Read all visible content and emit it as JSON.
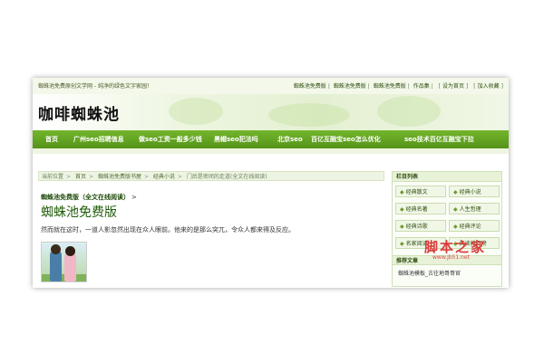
{
  "header": {
    "slogan": "蜘蛛池免费原创文学网 - 纯净的绿色文字家园！",
    "links": [
      "蜘蛛池免费版",
      "蜘蛛池免费版",
      "蜘蛛池免费版",
      "作品集",
      "设为首页",
      "加入收藏"
    ]
  },
  "logo": "咖啡蜘蛛池",
  "nav": {
    "items": [
      "首页",
      "广州seo招聘信息",
      "做seo工资一般多少钱",
      "黑帽seo犯法吗",
      "北京seo",
      "百亿互融宝seo怎么优化",
      "seo技术百亿互融宝下拉"
    ]
  },
  "breadcrumb": {
    "items": [
      "当前位置",
      "首页",
      "蜘蛛池免费版书屋",
      "经典小说",
      "门后是密闭的走道(全文在线阅读)"
    ]
  },
  "article": {
    "subtitle": "蜘蛛池免费版（全文在线阅读）",
    "subtitle_suffix": ">",
    "title": "蜘蛛池免费版",
    "intro": "然而就在这时，一道人影忽然出现在众人眼前。他来的是那么突兀，令众人都来得及反应。"
  },
  "sidebar": {
    "heading": "栏目列表",
    "items": [
      "经典散文",
      "经典小说",
      "经典名著",
      "人生哲理",
      "经典诗歌",
      "经典评论",
      "名家阅读",
      "阅读排行榜"
    ],
    "heading2": "推荐文章",
    "article": "蜘蛛池模板_古往地哥哥官"
  },
  "watermark": {
    "text": "脚本之家",
    "url": "www.jb51.net"
  },
  "colors": {
    "nav_green": "#5a9a1c",
    "title_green": "#1f5c08",
    "watermark_red": "#d93b3b"
  }
}
